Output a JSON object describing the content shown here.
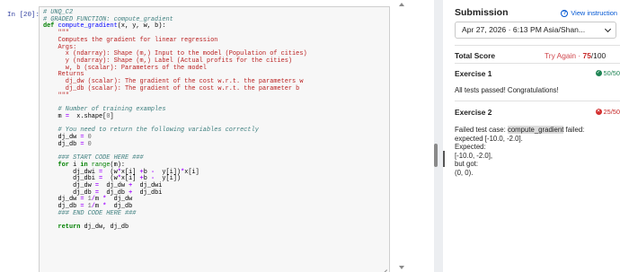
{
  "notebook": {
    "prompt": "In  [20]:",
    "code_lines": [
      [
        [
          "cm",
          "# UNQ_C2"
        ]
      ],
      [
        [
          "cm",
          "# GRADED FUNCTION: compute_gradient"
        ]
      ],
      [
        [
          "kw",
          "def "
        ],
        [
          "fn",
          "compute_gradient"
        ],
        [
          "",
          "(x, y, w, b):"
        ]
      ],
      [
        [
          "st",
          "    \"\"\""
        ]
      ],
      [
        [
          "st",
          "    Computes the gradient for linear regression"
        ]
      ],
      [
        [
          "st",
          "    Args:"
        ]
      ],
      [
        [
          "st",
          "      x (ndarray): Shape (m,) Input to the model (Population of cities)"
        ]
      ],
      [
        [
          "st",
          "      y (ndarray): Shape (m,) Label (Actual profits for the cities)"
        ]
      ],
      [
        [
          "st",
          "      w, b (scalar): Parameters of the model"
        ]
      ],
      [
        [
          "st",
          "    Returns"
        ]
      ],
      [
        [
          "st",
          "      dj_dw (scalar): The gradient of the cost w.r.t. the parameters w"
        ]
      ],
      [
        [
          "st",
          "      dj_db (scalar): The gradient of the cost w.r.t. the parameter b"
        ]
      ],
      [
        [
          "st",
          "    \"\"\""
        ]
      ],
      [
        [
          "",
          ""
        ]
      ],
      [
        [
          "cm",
          "    # Number of training examples"
        ]
      ],
      [
        [
          "",
          "    m "
        ],
        [
          "op",
          "="
        ],
        [
          "",
          "  x.shape["
        ],
        [
          "num",
          "0"
        ],
        [
          "",
          "]"
        ]
      ],
      [
        [
          "",
          ""
        ]
      ],
      [
        [
          "cm",
          "    # You need to return the following variables correctly"
        ]
      ],
      [
        [
          "",
          "    dj_dw "
        ],
        [
          "op",
          "="
        ],
        [
          "",
          ""
        ],
        [
          "num",
          " 0"
        ]
      ],
      [
        [
          "",
          "    dj_db "
        ],
        [
          "op",
          "="
        ],
        [
          "",
          ""
        ],
        [
          "num",
          " 0"
        ]
      ],
      [
        [
          "",
          ""
        ]
      ],
      [
        [
          "cm",
          "    ### START CODE HERE ###"
        ]
      ],
      [
        [
          "kw",
          "    for "
        ],
        [
          "",
          "i "
        ],
        [
          "kw",
          "in "
        ],
        [
          "nb",
          "range"
        ],
        [
          "",
          "(m):"
        ]
      ],
      [
        [
          "",
          "        dj_dwi "
        ],
        [
          "op",
          "="
        ],
        [
          "",
          "  (w"
        ],
        [
          "op",
          "*"
        ],
        [
          "",
          "x[i] "
        ],
        [
          "op",
          "+"
        ],
        [
          "",
          "b "
        ],
        [
          "op",
          "-"
        ],
        [
          "",
          "  y[i])"
        ],
        [
          "op",
          "*"
        ],
        [
          "",
          "x[i]"
        ]
      ],
      [
        [
          "",
          "        dj_dbi "
        ],
        [
          "op",
          "="
        ],
        [
          "",
          "  (w"
        ],
        [
          "op",
          "*"
        ],
        [
          "",
          "x[i] "
        ],
        [
          "op",
          "+"
        ],
        [
          "",
          "b "
        ],
        [
          "op",
          "-"
        ],
        [
          "",
          "  y[i])"
        ]
      ],
      [
        [
          "",
          "        dj_dw "
        ],
        [
          "op",
          "="
        ],
        [
          "",
          "  dj_dw "
        ],
        [
          "op",
          "+"
        ],
        [
          "",
          "  dj_dwi"
        ]
      ],
      [
        [
          "",
          "        dj_db "
        ],
        [
          "op",
          "="
        ],
        [
          "",
          "  dj_db "
        ],
        [
          "op",
          "+"
        ],
        [
          "",
          "  dj_dbi"
        ]
      ],
      [
        [
          "",
          "    dj_dw "
        ],
        [
          "op",
          "="
        ],
        [
          "",
          ""
        ],
        [
          "num",
          " 1"
        ],
        [
          "op",
          "/"
        ],
        [
          "",
          "m "
        ],
        [
          "op",
          "*"
        ],
        [
          "",
          "  dj_dw"
        ]
      ],
      [
        [
          "",
          "    dj_db "
        ],
        [
          "op",
          "="
        ],
        [
          "",
          ""
        ],
        [
          "num",
          " 1"
        ],
        [
          "op",
          "/"
        ],
        [
          "",
          "m "
        ],
        [
          "op",
          "*"
        ],
        [
          "",
          "  dj_db"
        ]
      ],
      [
        [
          "cm",
          "    ### END CODE HERE ###"
        ]
      ],
      [
        [
          "",
          ""
        ]
      ],
      [
        [
          "kw",
          "    return "
        ],
        [
          "",
          "dj_dw, dj_db"
        ]
      ]
    ]
  },
  "submission": {
    "title": "Submission",
    "view_instructions": "View instruction",
    "selected_date": "Apr 27, 2026 · 6:13 PM Asia/Shan...",
    "total_score_label": "Total Score",
    "try_again": "Try Again",
    "score_sep": " · ",
    "score_value": "75",
    "score_total": "/100",
    "exercise1": {
      "label": "Exercise 1",
      "score": "50/50",
      "status_color": "#1f8454",
      "message": "All tests passed! Congratulations!"
    },
    "exercise2": {
      "label": "Exercise 2",
      "score": "25/50",
      "status_color": "#c62828",
      "line1_pre": "Failed test case: ",
      "line1_code": "compute_gradient",
      "line1_post": " failed:",
      "line2": "expected [-10.0, -2.0].",
      "line3": "Expected:",
      "line4": "[-10.0, -2.0],",
      "line5": "but got:",
      "line6": "(0, 0)."
    }
  }
}
